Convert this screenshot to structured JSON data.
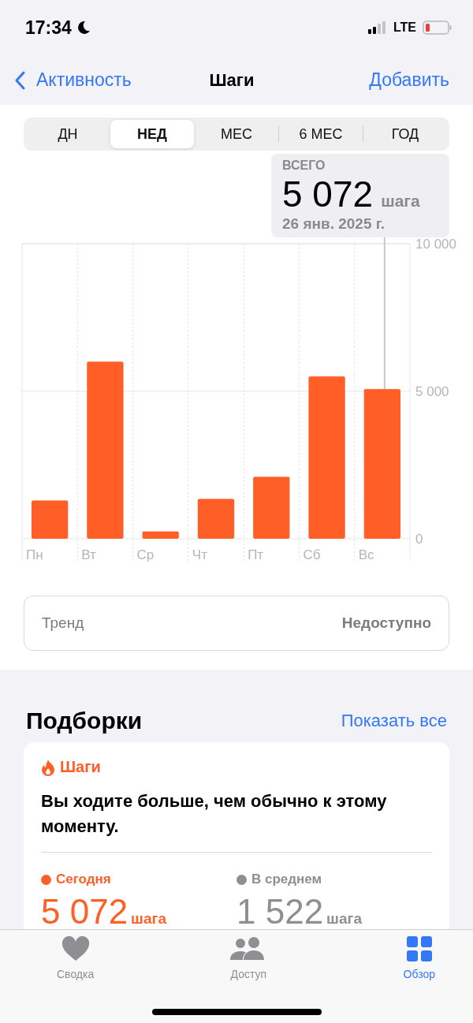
{
  "status_bar": {
    "time": "17:34",
    "network": "LTE"
  },
  "nav": {
    "back": "Активность",
    "title": "Шаги",
    "action": "Добавить"
  },
  "segments": [
    {
      "label": "ДН",
      "selected": false
    },
    {
      "label": "НЕД",
      "selected": true
    },
    {
      "label": "МЕС",
      "selected": false
    },
    {
      "label": "6 МЕС",
      "selected": false
    },
    {
      "label": "ГОД",
      "selected": false
    }
  ],
  "callout": {
    "label": "ВСЕГО",
    "value": "5 072",
    "unit": "шага",
    "date": "26 янв. 2025 г."
  },
  "chart_data": {
    "type": "bar",
    "categories": [
      "Пн",
      "Вт",
      "Ср",
      "Чт",
      "Пт",
      "Сб",
      "Вс"
    ],
    "series": [
      {
        "color": "#ff5f26",
        "values": [
          1300,
          6000,
          250,
          1350,
          2100,
          5500,
          5072
        ]
      }
    ],
    "ylim": [
      0,
      10000
    ],
    "yticks": [
      {
        "value": 0,
        "label": "0"
      },
      {
        "value": 5000,
        "label": "5 000"
      },
      {
        "value": 10000,
        "label": "10 000"
      }
    ]
  },
  "trend": {
    "label": "Тренд",
    "value": "Недоступно"
  },
  "highlights": {
    "title": "Подборки",
    "link": "Показать все",
    "card": {
      "category": "Шаги",
      "text": "Вы ходите больше, чем обычно к этому моменту.",
      "stats": [
        {
          "label": "Сегодня",
          "color": "#ff5f26",
          "value": "5 072",
          "unit": "шага"
        },
        {
          "label": "В среднем",
          "color": "#8e8e93",
          "value": "1 522",
          "unit": "шага"
        }
      ]
    }
  },
  "tab_bar": [
    {
      "kind": "heart",
      "label": "Сводка",
      "selected": false
    },
    {
      "kind": "people",
      "label": "Доступ",
      "selected": false
    },
    {
      "kind": "grid",
      "label": "Обзор",
      "selected": true
    }
  ]
}
